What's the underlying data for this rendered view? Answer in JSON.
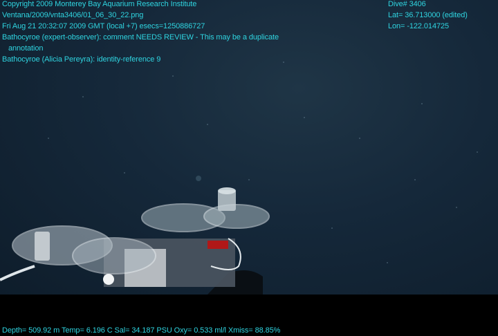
{
  "overlay": {
    "copyright": "Copyright 2009 Monterey Bay Aquarium Research Institute",
    "file": "Ventana/2009/vnta3406/01_06_30_22.png",
    "datetime": "Fri Aug 21 20:32:07 2009 GMT (local +7)  esecs=1250886727",
    "comment_line1": "Bathocyroe (expert-observer): comment NEEDS REVIEW - This may be a duplicate",
    "comment_line2": "annotation",
    "identity": "Bathocyroe (Alicia Pereyra): identity-reference 9",
    "dive": "Dive# 3406",
    "lat": "Lat= 36.713000 (edited)",
    "lon": "Lon= -122.014725",
    "telemetry": "Depth= 509.92 m  Temp= 6.196 C  Sal= 34.187 PSU  Oxy= 0.533 ml/l  Xmiss= 88.85%"
  },
  "colors": {
    "overlay_text": "#2fd4e0",
    "water": "#15283a"
  }
}
